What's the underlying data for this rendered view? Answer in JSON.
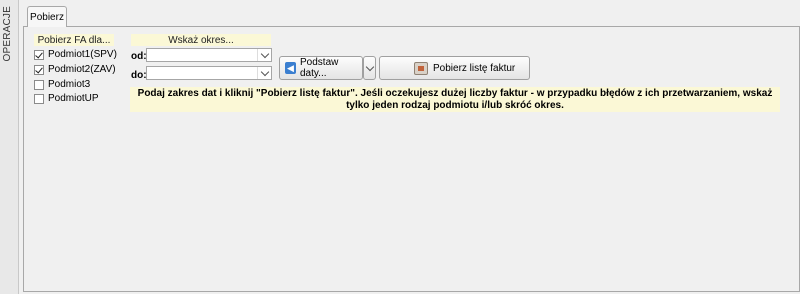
{
  "side_rail": {
    "label": "OPERACJE"
  },
  "tabs": [
    {
      "label": "Pobierz"
    }
  ],
  "entities": {
    "header": "Pobierz FA dla...",
    "items": [
      {
        "label": "Podmiot1(SPV)",
        "checked": true
      },
      {
        "label": "Podmiot2(ZAV)",
        "checked": true
      },
      {
        "label": "Podmiot3",
        "checked": false
      },
      {
        "label": "PodmiotUP",
        "checked": false
      }
    ]
  },
  "period": {
    "header": "Wskaż okres...",
    "from_label": "od:",
    "to_label": "do:",
    "from_value": "",
    "to_value": ""
  },
  "actions": {
    "preset_label": "Podstaw daty...",
    "fetch_label": "Pobierz listę faktur"
  },
  "info_message": "Podaj zakres dat i kliknij \"Pobierz listę faktur\". Jeśli oczekujesz dużej liczby faktur - w przypadku błędów z ich przetwarzaniem, wskaż tylko jeden rodzaj podmiotu i/lub skróć okres.",
  "colors": {
    "hint_bg": "#fbf8d6",
    "accent_blue": "#3b7fd0"
  }
}
